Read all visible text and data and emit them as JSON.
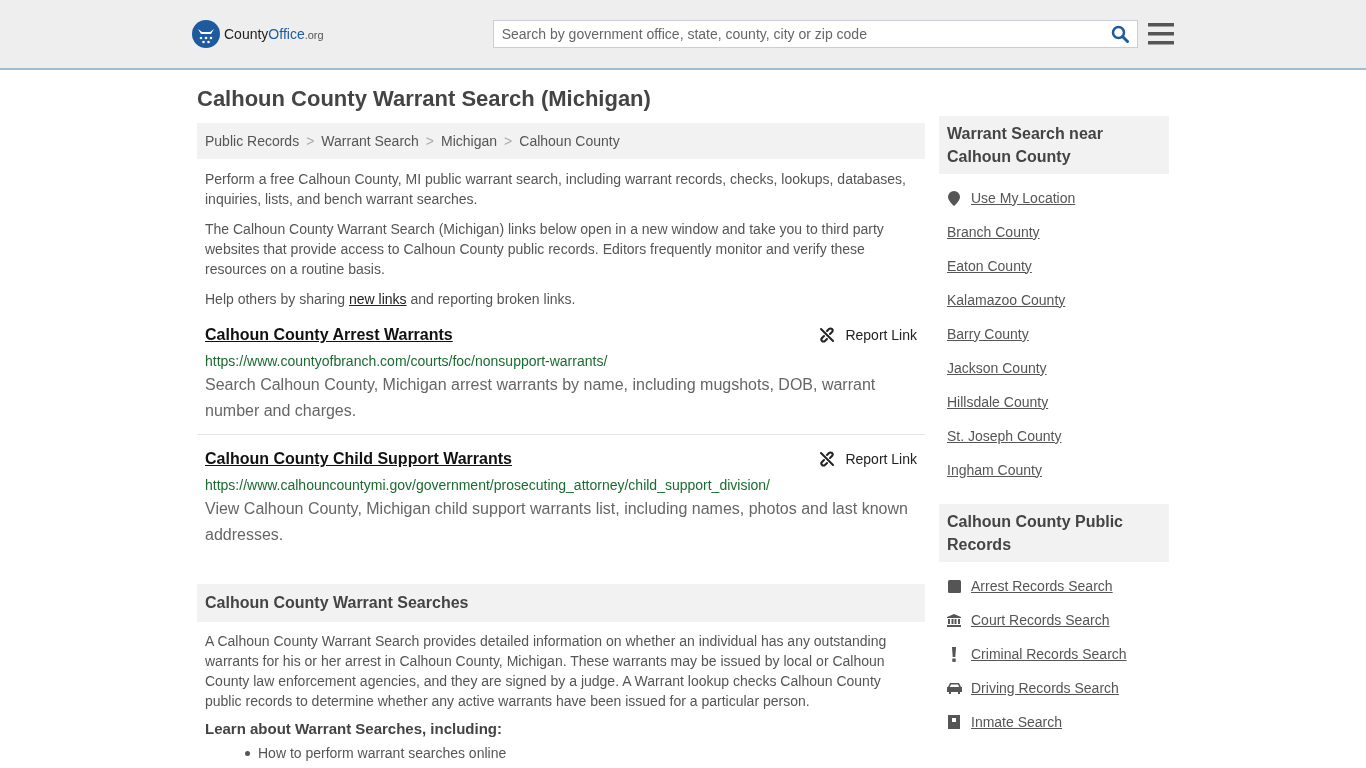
{
  "header": {
    "logo": {
      "name": "County",
      "accent": "Office",
      "suffix": ".org"
    },
    "search": {
      "placeholder": "Search by government office, state, county, city or zip code"
    }
  },
  "title": "Calhoun County Warrant Search (Michigan)",
  "breadcrumb_separator": ">",
  "breadcrumbs": [
    {
      "label": "Public Records"
    },
    {
      "label": "Warrant Search"
    },
    {
      "label": "Michigan"
    },
    {
      "label": "Calhoun County"
    }
  ],
  "intro": [
    "Perform a free Calhoun County, MI public warrant search, including warrant records, checks, lookups, databases, inquiries, lists, and bench warrant searches.",
    "The Calhoun County Warrant Search (Michigan) links below open in a new window and take you to third party websites that provide access to Calhoun County public records. Editors frequently monitor and verify these resources on a routine basis."
  ],
  "share": {
    "before": "Help others by sharing",
    "link": "new links",
    "after": "and reporting broken links."
  },
  "links": [
    {
      "title": "Calhoun County Arrest Warrants",
      "url": "https://www.countyofbranch.com/courts/foc/nonsupport-warrants/",
      "description": "Search Calhoun County, Michigan arrest warrants by name, including mugshots, DOB, warrant number and charges.",
      "report": "Report Link"
    },
    {
      "title": "Calhoun County Child Support Warrants",
      "url": "https://www.calhouncountymi.gov/government/prosecuting_attorney/child_support_division/",
      "description": "View Calhoun County, Michigan child support warrants list, including names, photos and last known addresses.",
      "report": "Report Link"
    }
  ],
  "section": {
    "heading": "Calhoun County Warrant Searches",
    "body": "A Calhoun County Warrant Search provides detailed information on whether an individual has any outstanding warrants for his or her arrest in Calhoun County, Michigan. These warrants may be issued by local or Calhoun County law enforcement agencies, and they are signed by a judge. A Warrant lookup checks Calhoun County public records to determine whether any active warrants have been issued for a particular person.",
    "subheading": "Learn about Warrant Searches, including:",
    "bullets": [
      "How to perform warrant searches online"
    ]
  },
  "sidebar": [
    {
      "heading": "Warrant Search near Calhoun County",
      "items": [
        {
          "label": "Use My Location",
          "kind": "location"
        },
        {
          "label": "Branch County"
        },
        {
          "label": "Eaton County"
        },
        {
          "label": "Kalamazoo County"
        },
        {
          "label": "Barry County"
        },
        {
          "label": "Jackson County"
        },
        {
          "label": "Hillsdale County"
        },
        {
          "label": "St. Joseph County"
        },
        {
          "label": "Ingham County"
        }
      ]
    },
    {
      "heading": "Calhoun County Public Records",
      "items": [
        {
          "label": "Arrest Records Search",
          "kind": "square"
        },
        {
          "label": "Court Records Search",
          "kind": "courthouse"
        },
        {
          "label": "Criminal Records Search",
          "kind": "exclamation"
        },
        {
          "label": "Driving Records Search",
          "kind": "car"
        },
        {
          "label": "Inmate Search",
          "kind": "inmate"
        }
      ]
    }
  ]
}
